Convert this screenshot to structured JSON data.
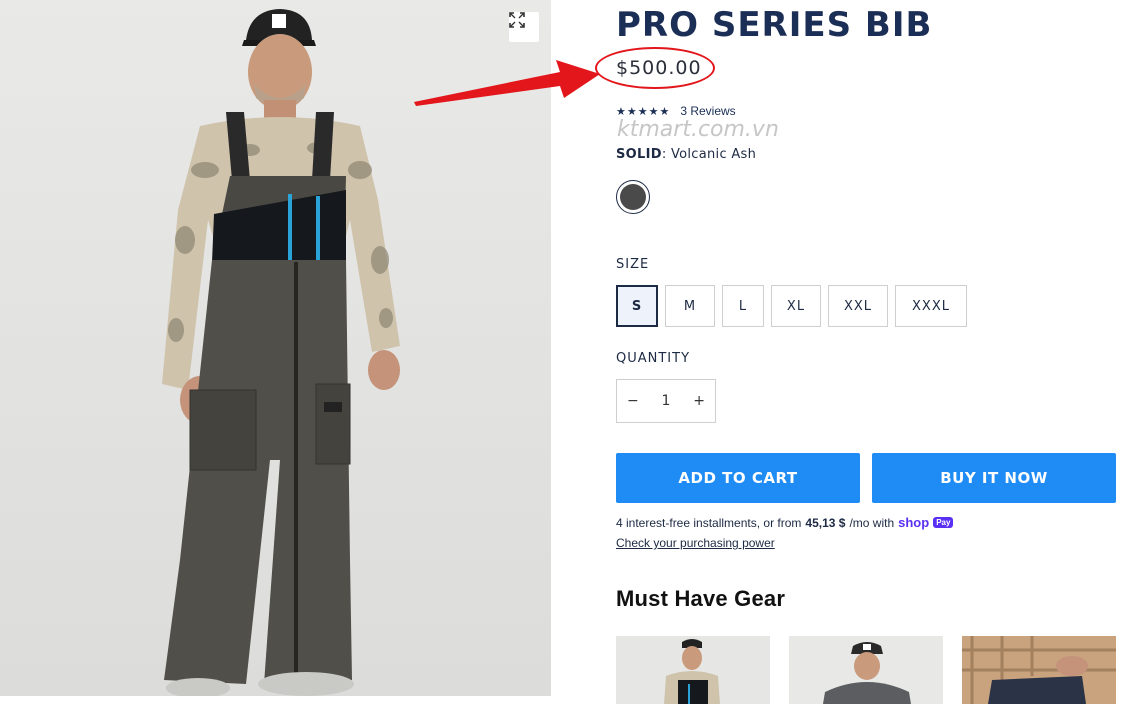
{
  "product": {
    "title": "PRO SERIES BIB",
    "price": "$500.00",
    "rating_stars": "★★★★★",
    "reviews": "3 Reviews",
    "variant_label": "SOLID",
    "variant_value": ": Volcanic Ash",
    "swatch_color": "#4a4a4a"
  },
  "watermark": "ktmart.com.vn",
  "size": {
    "label": "SIZE",
    "options": [
      "S",
      "M",
      "L",
      "XL",
      "XXL",
      "XXXL"
    ],
    "selected": "S"
  },
  "quantity": {
    "label": "QUANTITY",
    "minus": "−",
    "value": "1",
    "plus": "+"
  },
  "actions": {
    "add_to_cart": "ADD TO CART",
    "buy_it_now": "BUY IT NOW"
  },
  "installments": {
    "prefix": "4 interest-free installments, or from",
    "amount": "45,13 $",
    "suffix": "/mo with",
    "brand": "shop",
    "badge": "Pay",
    "link": "Check your purchasing power"
  },
  "gear": {
    "title": "Must Have Gear"
  },
  "colors": {
    "accent": "#1f8bf5",
    "title": "#1b2e55",
    "annotation": "#e3161c",
    "shop_pay": "#5a31f4"
  }
}
